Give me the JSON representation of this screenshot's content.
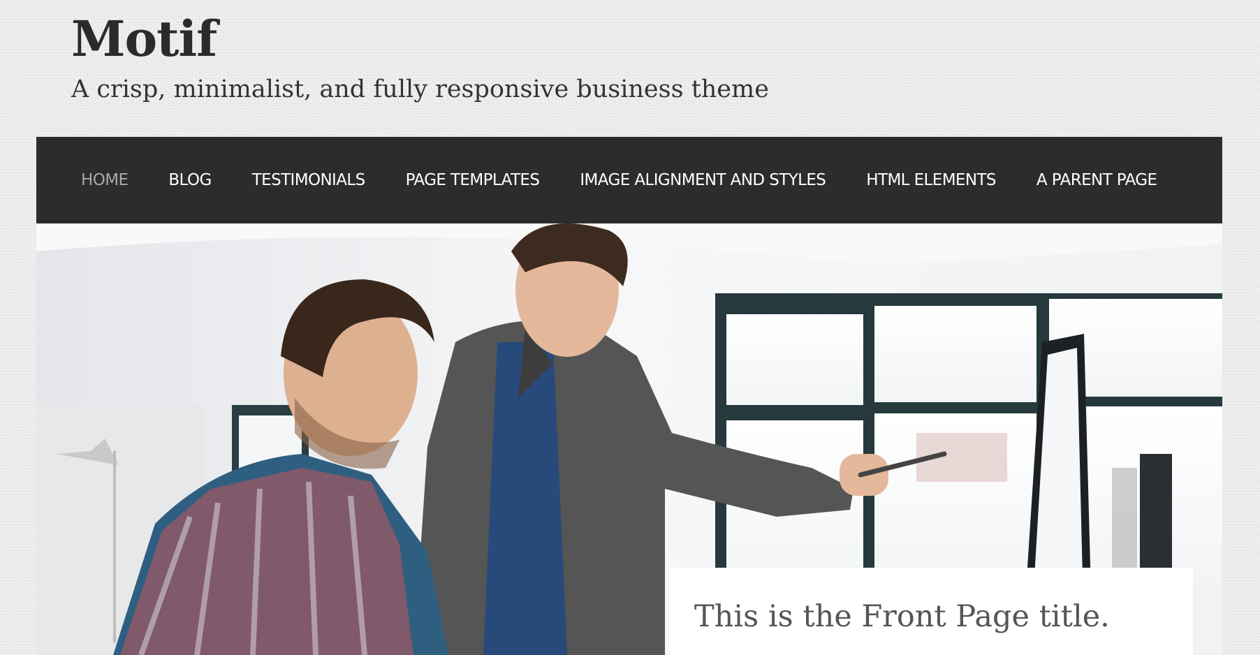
{
  "site": {
    "title": "Motif",
    "tagline": "A crisp, minimalist, and fully responsive business theme"
  },
  "nav": {
    "active_index": 0,
    "items": [
      {
        "label": "Home"
      },
      {
        "label": "Blog"
      },
      {
        "label": "Testimonials"
      },
      {
        "label": "Page Templates"
      },
      {
        "label": "Image Alignment and Styles"
      },
      {
        "label": "HTML Elements"
      },
      {
        "label": "A Parent Page"
      }
    ]
  },
  "hero": {
    "front_page_title": "This is the Front Page title."
  },
  "colors": {
    "nav_background": "#2c2c2c",
    "nav_active": "#a9a9a9",
    "nav_text": "#ffffff",
    "title_text": "#2b2b2b",
    "card_background": "#ffffff"
  }
}
